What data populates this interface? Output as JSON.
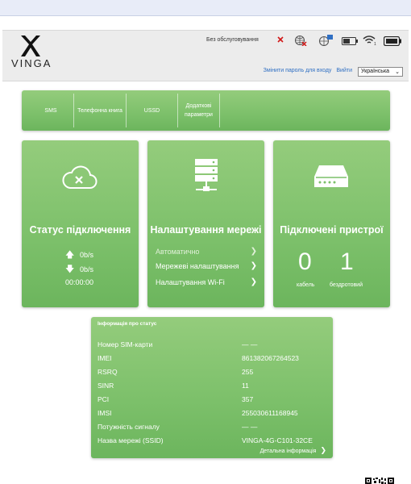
{
  "header": {
    "brand": "VINGA",
    "service_status": "Без обслуговування",
    "change_password": "Змінити пароль для входу",
    "logout": "Вийти",
    "language": "Українська",
    "network_signal_label": "1",
    "icons": [
      "sim-error-icon",
      "roaming-off-icon",
      "upload-icon",
      "battery-icon",
      "wifi-icon",
      "battery-full-icon"
    ]
  },
  "tabs": [
    {
      "label": "SMS"
    },
    {
      "label": "Телефонна книга"
    },
    {
      "label": "USSD"
    },
    {
      "label": "Додаткові параметри"
    }
  ],
  "cards": {
    "connection": {
      "title": "Статус підключення",
      "upload": "0b/s",
      "download": "0b/s",
      "time": "00:00:00"
    },
    "network": {
      "title": "Налаштування мережі",
      "items": [
        "Автоматично",
        "Мережеві налаштування",
        "Налаштування Wi-Fi"
      ]
    },
    "devices": {
      "title": "Підключені пристрої",
      "cable_count": "0",
      "wireless_count": "1",
      "cable_label": "кабель",
      "wireless_label": "бездротовий"
    }
  },
  "info": {
    "title": "Інформація про статус",
    "rows": [
      {
        "label": "Номер SIM-карти",
        "value": "— —"
      },
      {
        "label": "IMEI",
        "value": "861382067264523"
      },
      {
        "label": "RSRQ",
        "value": "255"
      },
      {
        "label": "SINR",
        "value": "11"
      },
      {
        "label": "PCI",
        "value": "357"
      },
      {
        "label": "IMSI",
        "value": "255030611168945"
      },
      {
        "label": "Потужність сигналу",
        "value": "— —"
      },
      {
        "label": "Назва мережі (SSID)",
        "value": "VINGA-4G-C101-32CE"
      }
    ],
    "detail_link": "Детальна інформація"
  },
  "colors": {
    "accent_green": "#7cc06a",
    "link_blue": "#2f6fc3",
    "error_red": "#d11818"
  }
}
